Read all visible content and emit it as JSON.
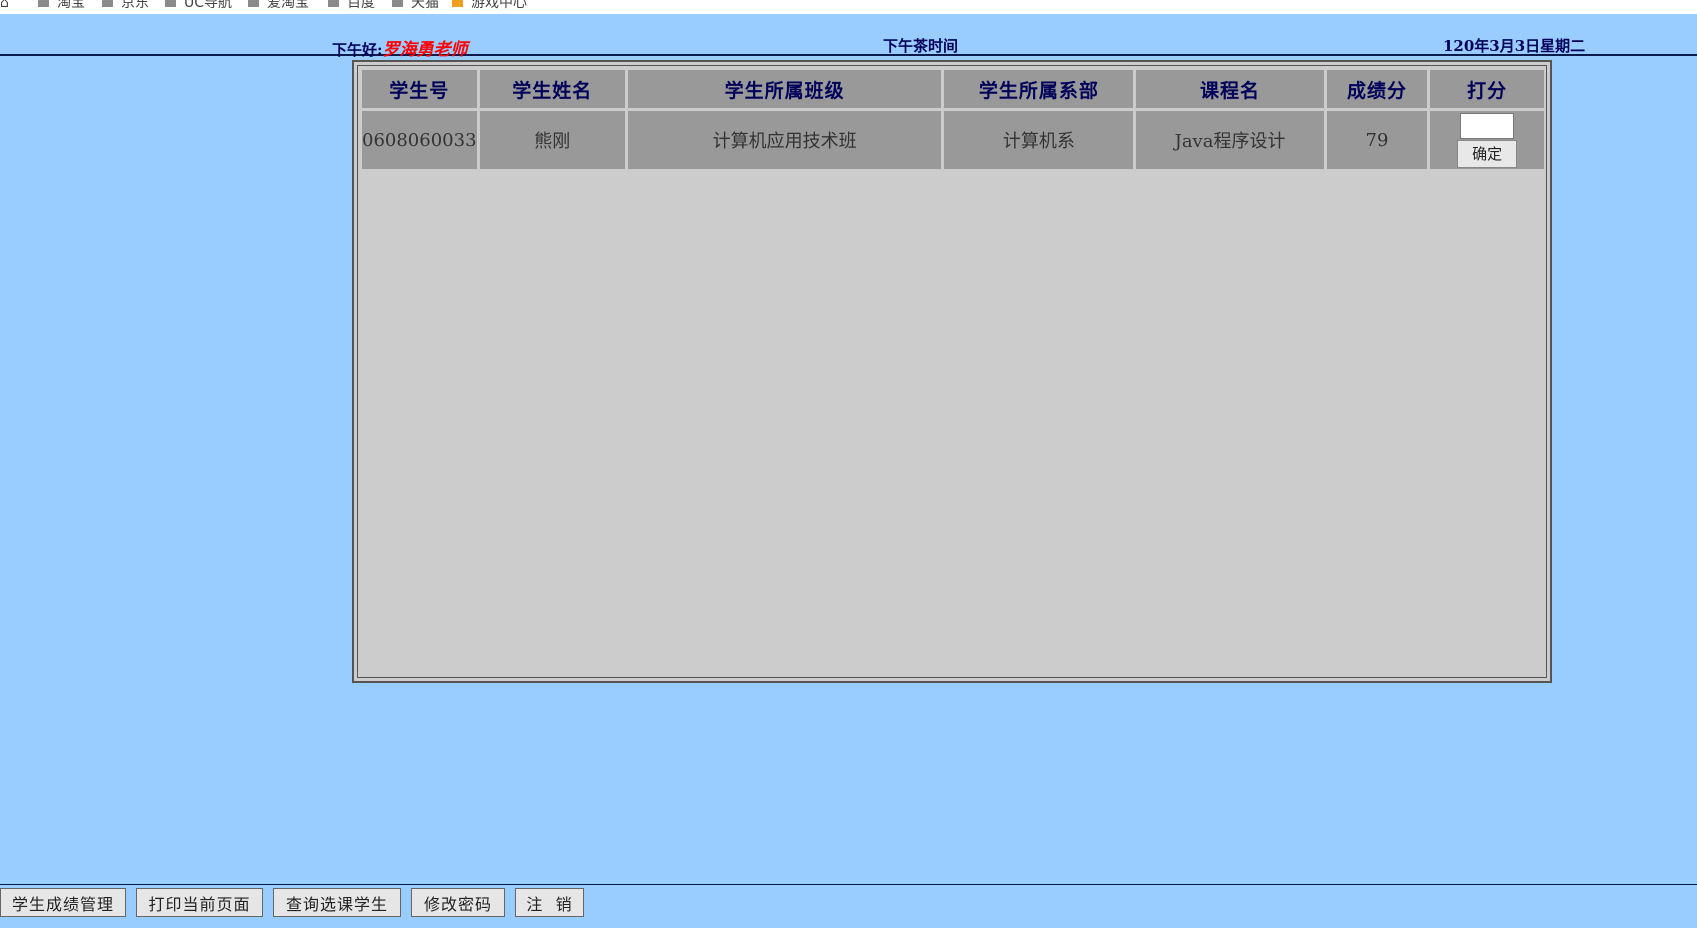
{
  "bookmarks": [
    "淘宝",
    "京东",
    "UC导航",
    "爱淘宝",
    "百度",
    "天猫",
    "游戏中心"
  ],
  "header": {
    "greeting": "下午好:",
    "teacher": "罗海勇老师",
    "center_text": "下午茶时间",
    "date": "120年3月3日星期二"
  },
  "table": {
    "columns": [
      "学生号",
      "学生姓名",
      "学生所属班级",
      "学生所属系部",
      "课程名",
      "成绩分",
      "打分"
    ],
    "rows": [
      {
        "student_id": "0608060033",
        "name": "熊刚",
        "class": "计算机应用技术班",
        "department": "计算机系",
        "course": "Java程序设计",
        "score": "79",
        "score_input": "",
        "confirm": "确定"
      }
    ]
  },
  "footer": {
    "buttons": [
      "学生成绩管理",
      "打印当前页面",
      "查询选课学生",
      "修改密码",
      "注  销"
    ]
  }
}
